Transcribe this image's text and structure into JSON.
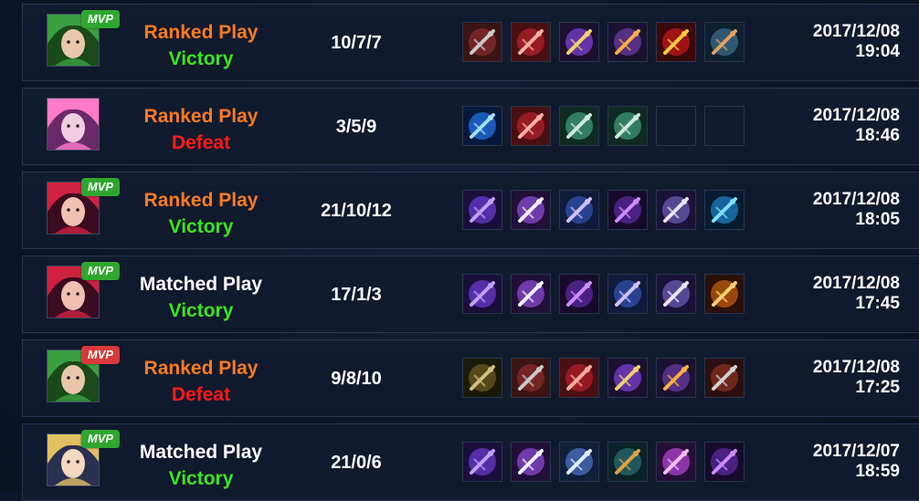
{
  "colors": {
    "ranked": "#ff7a1f",
    "matched": "#ffffff",
    "victory": "#39e81e",
    "defeat": "#ff1a1a",
    "mvp_win": "#2fa62f",
    "mvp_loss": "#d83a3a"
  },
  "matches": [
    {
      "hero_icon": "green-haired-hero-portrait",
      "mvp": true,
      "mvp_label": "MVP",
      "mvp_type": "win",
      "mode": "Ranked Play",
      "mode_type": "ranked",
      "result": "Victory",
      "result_type": "victory",
      "kda": "10/7/7",
      "items": [
        "dark-armor-item-icon",
        "red-boots-item-icon",
        "purple-spear-item-icon",
        "ornate-blade-item-icon",
        "red-amulet-item-icon",
        "crossed-swords-item-icon"
      ],
      "date": "2017/12/08",
      "time": "19:04"
    },
    {
      "hero_icon": "pink-haired-hero-portrait",
      "mvp": false,
      "mode": "Ranked Play",
      "mode_type": "ranked",
      "result": "Defeat",
      "result_type": "defeat",
      "kda": "3/5/9",
      "items": [
        "blue-orb-item-icon",
        "red-boots-item-icon",
        "green-tome-item-icon",
        "green-tome-item-icon",
        "empty",
        "empty"
      ],
      "date": "2017/12/08",
      "time": "18:46"
    },
    {
      "hero_icon": "red-haired-hero-portrait",
      "mvp": true,
      "mvp_label": "MVP",
      "mvp_type": "win",
      "mode": "Ranked Play",
      "mode_type": "ranked",
      "result": "Victory",
      "result_type": "victory",
      "kda": "21/10/12",
      "items": [
        "purple-crossbow-item-icon",
        "winged-claw-item-icon",
        "blue-boots-item-icon",
        "dark-crown-item-icon",
        "scroll-item-icon",
        "blue-staff-item-icon"
      ],
      "date": "2017/12/08",
      "time": "18:05"
    },
    {
      "hero_icon": "red-haired-hero-portrait",
      "mvp": true,
      "mvp_label": "MVP",
      "mvp_type": "win",
      "mode": "Matched Play",
      "mode_type": "matched",
      "result": "Victory",
      "result_type": "victory",
      "kda": "17/1/3",
      "items": [
        "purple-crossbow-item-icon",
        "winged-claw-item-icon",
        "dark-crown-item-icon",
        "blue-boots-item-icon",
        "scroll-item-icon",
        "fire-orb-item-icon"
      ],
      "date": "2017/12/08",
      "time": "17:45"
    },
    {
      "hero_icon": "green-haired-hero-portrait",
      "mvp": true,
      "mvp_label": "MVP",
      "mvp_type": "loss",
      "mode": "Ranked Play",
      "mode_type": "ranked",
      "result": "Defeat",
      "result_type": "defeat",
      "kda": "9/8/10",
      "items": [
        "crossbow-item-icon",
        "dark-armor-item-icon",
        "red-boots-item-icon",
        "purple-spear-item-icon",
        "ornate-blade-item-icon",
        "hammer-item-icon"
      ],
      "date": "2017/12/08",
      "time": "17:25"
    },
    {
      "hero_icon": "blonde-hero-portrait",
      "mvp": true,
      "mvp_label": "MVP",
      "mvp_type": "win",
      "mode": "Matched Play",
      "mode_type": "matched",
      "result": "Victory",
      "result_type": "victory",
      "kda": "21/0/6",
      "items": [
        "purple-crossbow-item-icon",
        "winged-claw-item-icon",
        "winged-boots-item-icon",
        "shield-item-icon",
        "purple-ring-item-icon",
        "dark-crown-item-icon"
      ],
      "date": "2017/12/07",
      "time": "18:59"
    }
  ]
}
